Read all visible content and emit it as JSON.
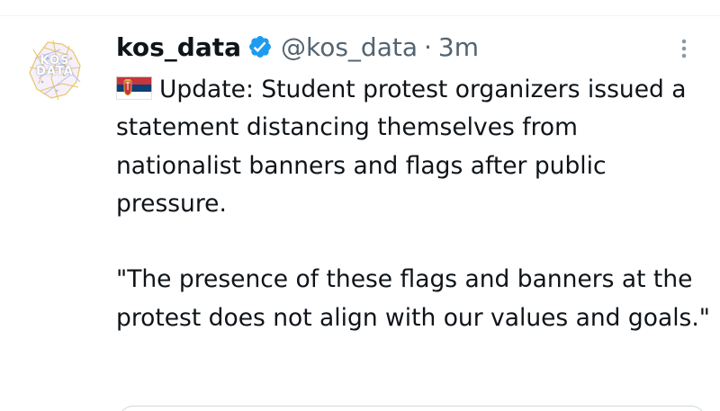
{
  "tweet": {
    "display_name": "kos_data",
    "handle": "@kos_data",
    "separator": "·",
    "time": "3m",
    "avatar_text_line1": "KOS",
    "avatar_text_line2": "DATA",
    "flag_icon": "serbian-flag",
    "paragraph1": "Update: Student protest organizers issued a statement distancing themselves from nationalist banners and flags after public pressure.",
    "paragraph2": "\"The presence of these flags and banners at the protest does not align with our values and goals.\""
  },
  "icons": {
    "verified": "verified-badge-icon",
    "more": "more-vertical-icon"
  },
  "colors": {
    "verified_blue": "#1d9bf0",
    "text": "#0f1419",
    "secondary_text": "#536471",
    "divider": "#eff3f4",
    "avatar_gold": "#e8c46a",
    "avatar_purple": "#b9bde6"
  }
}
